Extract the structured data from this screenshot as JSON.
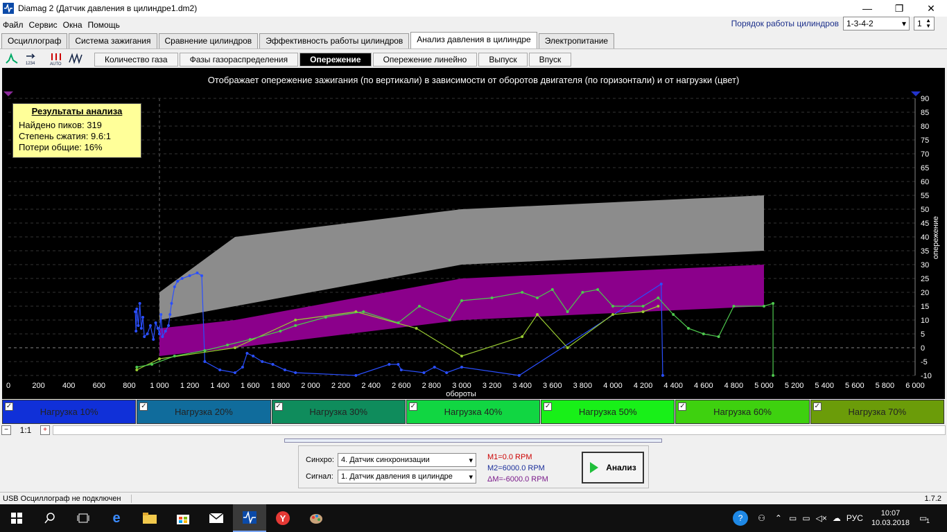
{
  "window": {
    "title": "Diamag 2 (Датчик давления в цилиндре1.dm2)"
  },
  "menu": [
    "Файл",
    "Сервис",
    "Окна",
    "Помощь"
  ],
  "cylinder_order": {
    "label": "Порядок работы цилиндров",
    "value": "1-3-4-2",
    "cylinder": "1"
  },
  "tabs": [
    "Осциллограф",
    "Система зажигания",
    "Сравнение цилиндров",
    "Эффективность работы цилиндров",
    "Анализ давления в цилиндре",
    "Электропитание"
  ],
  "active_tab": 4,
  "toolbar_icons": [
    "pressure-icon",
    "numbers-1234-icon",
    "auto-icon",
    "peaks-icon"
  ],
  "subtabs": [
    "Количество газа",
    "Фазы газораспределения",
    "Опережение",
    "Опережение линейно",
    "Выпуск",
    "Впуск"
  ],
  "active_subtab": 2,
  "results": {
    "title": "Результаты анализа",
    "peaks": "Найдено пиков: 319",
    "compression": "Степень сжатия: 9.6:1",
    "losses": "Потери общие: 16%"
  },
  "chart_data": {
    "type": "scatter",
    "title": "Отображает опережение зажигания (по вертикали) в зависимости от оборотов двигателя (по горизонтали) и от нагрузки (цвет)",
    "xlabel": "обороты",
    "ylabel": "опережение",
    "xlim": [
      0,
      6000
    ],
    "ylim": [
      -10,
      90
    ],
    "xticks": [
      "0",
      "200",
      "400",
      "600",
      "800",
      "1 000",
      "1 200",
      "1 400",
      "1 600",
      "1 800",
      "2 000",
      "2 200",
      "2 400",
      "2 600",
      "2 800",
      "3 000",
      "3 200",
      "3 400",
      "3 600",
      "3 800",
      "4 000",
      "4 200",
      "4 400",
      "4 600",
      "4 800",
      "5 000",
      "5 200",
      "5 400",
      "5 600",
      "5 800",
      "6 000"
    ],
    "yticks": [
      "-10",
      "-5",
      "0",
      "5",
      "10",
      "15",
      "20",
      "25",
      "30",
      "35",
      "40",
      "45",
      "50",
      "55",
      "60",
      "65",
      "70",
      "75",
      "80",
      "85",
      "90"
    ],
    "bands": [
      {
        "name": "gray",
        "color": "#8c8c8c",
        "upper": [
          [
            1000,
            20
          ],
          [
            1500,
            40
          ],
          [
            3000,
            50
          ],
          [
            5000,
            55
          ]
        ],
        "lower": [
          [
            1000,
            10
          ],
          [
            1500,
            15
          ],
          [
            3000,
            30
          ],
          [
            5000,
            35
          ]
        ]
      },
      {
        "name": "magenta",
        "color": "#8b008b",
        "upper": [
          [
            1000,
            7
          ],
          [
            1500,
            10
          ],
          [
            3000,
            25
          ],
          [
            5000,
            30
          ]
        ],
        "lower": [
          [
            1000,
            -3
          ],
          [
            1500,
            0
          ],
          [
            3000,
            10
          ],
          [
            5000,
            15
          ]
        ]
      }
    ],
    "series": [
      {
        "color": "#2a4fff",
        "points": [
          [
            840,
            13
          ],
          [
            845,
            6
          ],
          [
            850,
            14
          ],
          [
            860,
            8
          ],
          [
            870,
            16
          ],
          [
            880,
            7
          ],
          [
            890,
            11
          ],
          [
            900,
            4
          ],
          [
            920,
            5
          ],
          [
            940,
            8
          ],
          [
            960,
            3
          ],
          [
            975,
            9
          ],
          [
            990,
            7
          ],
          [
            1000,
            5
          ],
          [
            1010,
            12
          ],
          [
            1020,
            4
          ],
          [
            1040,
            6
          ],
          [
            1060,
            8
          ],
          [
            1070,
            12
          ],
          [
            1080,
            16
          ],
          [
            1100,
            22
          ],
          [
            1120,
            24
          ],
          [
            1150,
            25
          ],
          [
            1200,
            26
          ],
          [
            1250,
            27
          ],
          [
            1280,
            26
          ],
          [
            1300,
            -5
          ],
          [
            1400,
            -8
          ],
          [
            1500,
            -9
          ],
          [
            1550,
            -7
          ],
          [
            1580,
            -2
          ],
          [
            1620,
            -3
          ],
          [
            1680,
            -5
          ],
          [
            1750,
            -6
          ],
          [
            1830,
            -8
          ],
          [
            1900,
            -9
          ],
          [
            2300,
            -10
          ],
          [
            2520,
            -6
          ],
          [
            2580,
            -6
          ],
          [
            2600,
            -8
          ],
          [
            2750,
            -9
          ],
          [
            2820,
            -7
          ],
          [
            2900,
            -9
          ],
          [
            3000,
            -7
          ],
          [
            3380,
            -10
          ],
          [
            4320,
            23
          ],
          [
            4330,
            -10
          ]
        ]
      },
      {
        "color": "#9acd32",
        "points": [
          [
            850,
            -8
          ],
          [
            1000,
            -4
          ],
          [
            1500,
            0
          ],
          [
            1900,
            10
          ],
          [
            2300,
            13
          ],
          [
            2700,
            7
          ],
          [
            3000,
            -3
          ],
          [
            3400,
            4
          ],
          [
            3500,
            12
          ],
          [
            3700,
            0
          ],
          [
            4000,
            12
          ],
          [
            4200,
            13
          ],
          [
            4300,
            15
          ]
        ]
      },
      {
        "color": "#4ec94e",
        "points": [
          [
            850,
            -7
          ],
          [
            950,
            -6
          ],
          [
            1100,
            -3
          ],
          [
            1300,
            -1
          ],
          [
            1450,
            1
          ],
          [
            1600,
            3
          ],
          [
            1800,
            6
          ],
          [
            1900,
            8
          ],
          [
            2100,
            11
          ],
          [
            2350,
            13
          ],
          [
            2580,
            9
          ],
          [
            2720,
            15
          ],
          [
            2920,
            10
          ],
          [
            3000,
            17
          ],
          [
            3200,
            18
          ],
          [
            3400,
            20
          ],
          [
            3500,
            18
          ],
          [
            3600,
            21
          ],
          [
            3700,
            13
          ],
          [
            3800,
            20
          ],
          [
            3900,
            21
          ],
          [
            4000,
            15
          ],
          [
            4200,
            15
          ],
          [
            4300,
            18
          ],
          [
            4400,
            12
          ],
          [
            4500,
            7
          ],
          [
            4600,
            5
          ],
          [
            4700,
            4
          ],
          [
            4800,
            15
          ],
          [
            5000,
            15
          ],
          [
            5060,
            16
          ],
          [
            5060,
            -10
          ]
        ]
      }
    ]
  },
  "loads": [
    {
      "label": "Нагрузка 10%",
      "color": "#1030d8"
    },
    {
      "label": "Нагрузка 20%",
      "color": "#106c9c"
    },
    {
      "label": "Нагрузка 30%",
      "color": "#0f8c5c"
    },
    {
      "label": "Нагрузка 40%",
      "color": "#11d642"
    },
    {
      "label": "Нагрузка 50%",
      "color": "#18f018"
    },
    {
      "label": "Нагрузка 60%",
      "color": "#3ed10f"
    },
    {
      "label": "Нагрузка 70%",
      "color": "#6b9c09"
    }
  ],
  "zoom": "1:1",
  "sync": {
    "label": "Синхро:",
    "value": "4.  Датчик синхронизации"
  },
  "signal": {
    "label": "Сигнал:",
    "value": "1.  Датчик давления в цилиндре"
  },
  "markers": {
    "m1": "M1=0.0 RPM",
    "m2": "M2=6000.0 RPM",
    "dm": "ΔM=-6000.0 RPM"
  },
  "analyze_button": "Анализ",
  "status": {
    "text": "USB Осциллограф не подключен",
    "version": "1.7.2"
  },
  "tray": {
    "lang": "РУС",
    "time": "10:07",
    "date": "10.03.2018",
    "notifications": "1"
  }
}
